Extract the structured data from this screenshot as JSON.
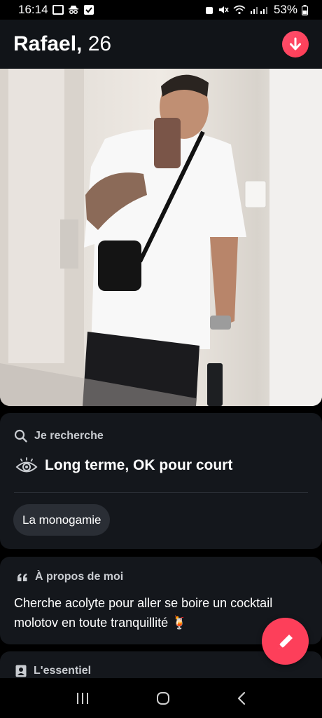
{
  "status_bar": {
    "time": "16:14",
    "battery": "53%"
  },
  "header": {
    "name": "Rafael,",
    "age": "26",
    "action_icon": "arrow-down-icon",
    "accent": "#fe3c54"
  },
  "photo": {
    "description_icon": "profile-photo"
  },
  "looking_for": {
    "heading": "Je recherche",
    "value": "Long terme, OK pour court",
    "chip": "La monogamie"
  },
  "about": {
    "heading": "À propos de moi",
    "text": "Cherche acolyte pour aller se boire un cocktail molotov en toute tranquillité 🍹"
  },
  "essentials": {
    "heading": "L'essentiel"
  },
  "fab": {
    "icon": "pencil-icon"
  },
  "nav": {
    "icons": [
      "recent-apps-icon",
      "home-icon",
      "back-icon"
    ]
  }
}
